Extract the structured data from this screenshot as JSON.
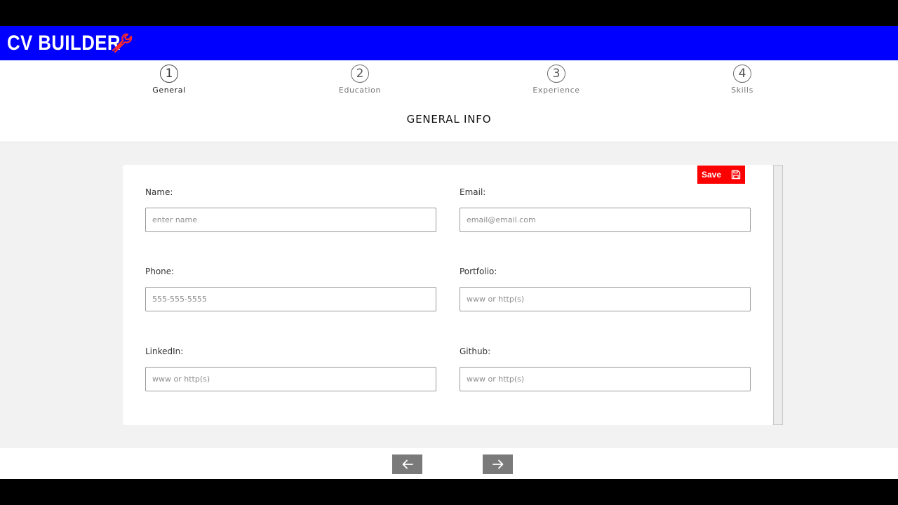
{
  "header": {
    "title": "CV BUILDER",
    "icon": "wrench-icon",
    "bg_color": "#0000fe",
    "icon_color": "#ff2a2a"
  },
  "steps": [
    {
      "number": "1",
      "label": "General",
      "active": true
    },
    {
      "number": "2",
      "label": "Education",
      "active": false
    },
    {
      "number": "3",
      "label": "Experience",
      "active": false
    },
    {
      "number": "4",
      "label": "Skills",
      "active": false
    }
  ],
  "section": {
    "title": "GENERAL INFO"
  },
  "save_button": {
    "label": "Save",
    "icon": "floppy-disk-icon",
    "color": "#fe0000"
  },
  "fields": {
    "name": {
      "label": "Name:",
      "placeholder": "enter name",
      "value": ""
    },
    "email": {
      "label": "Email:",
      "placeholder": "email@email.com",
      "value": ""
    },
    "phone": {
      "label": "Phone:",
      "placeholder": "555-555-5555",
      "value": ""
    },
    "portfolio": {
      "label": "Portfolio:",
      "placeholder": "www or http(s)",
      "value": ""
    },
    "linkedin": {
      "label": "LinkedIn:",
      "placeholder": "www or http(s)",
      "value": ""
    },
    "github": {
      "label": "Github:",
      "placeholder": "www or http(s)",
      "value": ""
    }
  },
  "navigation": {
    "prev_icon": "arrow-left-icon",
    "next_icon": "arrow-right-icon",
    "button_color": "#7a7a7a"
  }
}
